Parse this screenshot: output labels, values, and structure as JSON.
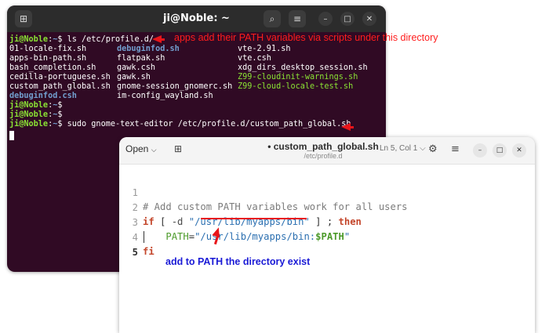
{
  "terminal": {
    "title": "ji@Noble: ~",
    "new_tab_icon": "new-tab-icon",
    "lines": [
      {
        "user": "ji@Noble",
        "sep": ":",
        "path": "~",
        "sym": "$",
        "cmd": " ls /etc/profile.d/"
      },
      {
        "cols": [
          "01-locale-fix.sh",
          "debuginfod.sh",
          "vte-2.91.sh"
        ]
      },
      {
        "cols": [
          "apps-bin-path.sh",
          "flatpak.sh",
          "vte.csh"
        ]
      },
      {
        "cols": [
          "bash_completion.sh",
          "gawk.csh",
          "xdg_dirs_desktop_session.sh"
        ]
      },
      {
        "cols": [
          "cedilla-portuguese.sh",
          "gawk.sh",
          "Z99-cloudinit-warnings.sh"
        ]
      },
      {
        "cols": [
          "custom_path_global.sh",
          "gnome-session_gnomerc.sh",
          "Z99-cloud-locale-test.sh"
        ]
      },
      {
        "cols": [
          "debuginfod.csh",
          "im-config_wayland.sh",
          ""
        ]
      },
      {
        "user": "ji@Noble",
        "sep": ":",
        "path": "~",
        "sym": "$",
        "cmd": ""
      },
      {
        "user": "ji@Noble",
        "sep": ":",
        "path": "~",
        "sym": "$",
        "cmd": ""
      },
      {
        "user": "ji@Noble",
        "sep": ":",
        "path": "~",
        "sym": "$",
        "cmd": " sudo gnome-text-editor /etc/profile.d/custom_path_global.sh"
      }
    ]
  },
  "annotations": {
    "top": "apps add their PATH variables via scripts under this directory",
    "bottom": "add to PATH the directory exist"
  },
  "editor": {
    "open_label": "Open",
    "modified_marker": "•",
    "filename": "custom_path_global.sh",
    "folder": "/etc/profile.d",
    "position": "Ln 5, Col 1",
    "code": {
      "l1_num": "1",
      "l1_comment": "# Add custom PATH variables work for all users",
      "l2_num": "2",
      "l2_if": "if",
      "l2_open": " [ ",
      "l2_flag": "-d",
      "l2_sp": " ",
      "l2_str": "\"/usr/lib/myapps/bin\"",
      "l2_close": " ] ; ",
      "l2_then": "then",
      "l3_num": "3",
      "l3_indent": "    ",
      "l3_var": "PATH",
      "l3_eq": "=",
      "l3_str_a": "\"/usr/lib/myapps/bin:",
      "l3_ref": "$PATH",
      "l3_str_b": "\"",
      "l4_num": "4",
      "l4_fi": "fi",
      "l5_num": "5"
    }
  }
}
